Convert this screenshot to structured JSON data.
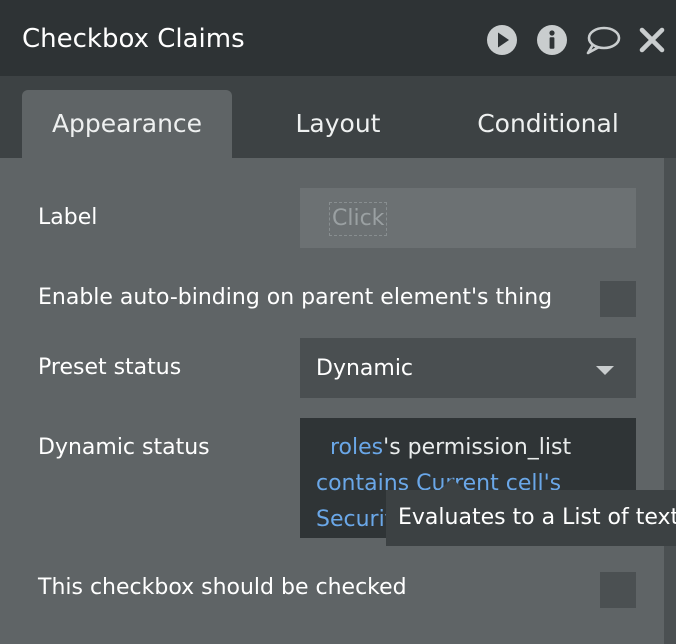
{
  "header": {
    "title": "Checkbox Claims",
    "icons": [
      "play-icon",
      "info-icon",
      "comment-icon",
      "close-icon"
    ]
  },
  "tabs": [
    {
      "label": "Appearance",
      "active": true
    },
    {
      "label": "Layout",
      "active": false
    },
    {
      "label": "Conditional",
      "active": false
    }
  ],
  "properties": {
    "label": {
      "name": "Label",
      "placeholder": "Click"
    },
    "auto_binding": {
      "name": "Enable auto-binding on parent element's thing",
      "checked": false
    },
    "preset_status": {
      "name": "Preset status",
      "value": "Dynamic"
    },
    "dynamic_status": {
      "name": "Dynamic status",
      "expression": {
        "line1_part1": "roles",
        "line1_part2": "'s permission_list",
        "line2": "contains Current cell's",
        "line3": "Security"
      }
    },
    "should_be_checked": {
      "name": "This checkbox should be checked",
      "checked": false
    }
  },
  "tooltip": {
    "text": "Evaluates to a List of texts"
  },
  "colors": {
    "titlebar": "#2e3335",
    "tabbar": "#3d4244",
    "panel": "#5f6466",
    "expression_blue": "#6aa7e8"
  }
}
